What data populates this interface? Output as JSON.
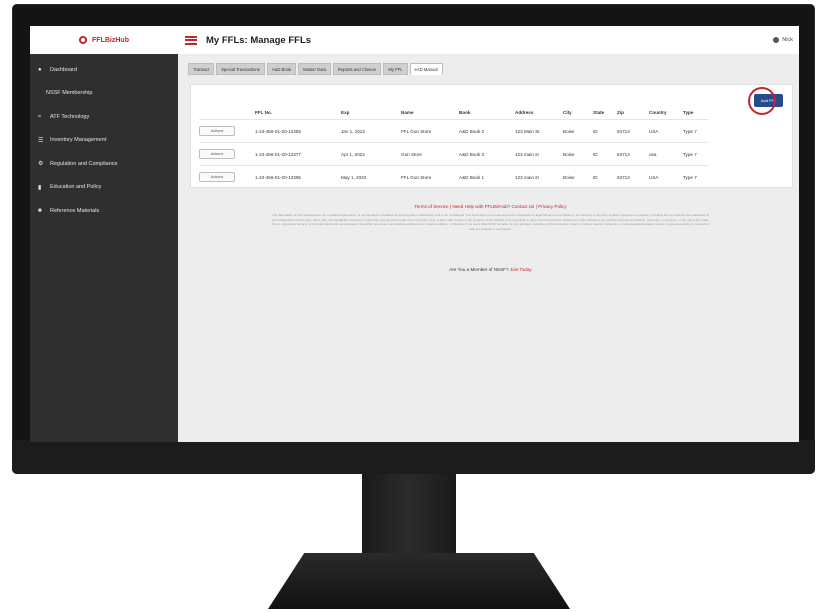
{
  "brand": {
    "name": "FFLBizHub",
    "color": "#c0262d"
  },
  "header": {
    "title": "My FFLs: Manage FFLs",
    "user_name": "Nick",
    "menu_icon": "hamburger-icon",
    "user_icon": "user-icon"
  },
  "sidebar": {
    "items": [
      {
        "label": "Dashboard",
        "icon": "home-icon"
      },
      {
        "label": "NSSF Membership",
        "icon": ""
      },
      {
        "label": "ATF Technology",
        "icon": "chart-icon"
      },
      {
        "label": "Inventory Management",
        "icon": "list-icon"
      },
      {
        "label": "Regulation and Compliance",
        "icon": "gear-icon"
      },
      {
        "label": "Education and Policy",
        "icon": "book-icon"
      },
      {
        "label": "Reference Materials",
        "icon": "document-icon"
      }
    ]
  },
  "tabs": [
    "Transact",
    "Special Transactions",
    "A&D Book",
    "Master Data",
    "Reports and Closure",
    "My FFL",
    "eAD Manual"
  ],
  "active_tab": "eAD Manual",
  "panel": {
    "add_button": "Add FFL",
    "columns": [
      "FFL No.",
      "Exp",
      "Name",
      "Book",
      "Address",
      "City",
      "State",
      "Zip",
      "Country",
      "Type"
    ],
    "action_label": "Actions",
    "rows": [
      [
        "1-23-456-01-20-12355",
        "Jan 1, 2022",
        "FFL Gun Store",
        "A&D Book 2",
        "123 Main St",
        "Boise",
        "ID",
        "83713",
        "USA",
        "Type 7"
      ],
      [
        "1-23-456-01-20-12377",
        "Apr 1, 2022",
        "Gun Store",
        "A&D Book 3",
        "123 main st",
        "Boise",
        "ID",
        "83713",
        "usa",
        "Type 7"
      ],
      [
        "1-23-456-01-20-12395",
        "May 1, 2022",
        "FFL Gun Store",
        "A&D Book 1",
        "123 main st",
        "Boise",
        "ID",
        "83713",
        "USA",
        "Type 7"
      ]
    ]
  },
  "footer": {
    "links": [
      "Terms of Service",
      "Need Help with FFLBizHub? Contact Us",
      "Privacy Policy"
    ],
    "disclaimer": "The information on this website does not constitute legal advice, is not intended to establish an attorney-client relationship, and is not confidential. The information is not intended to be a substitute for legal advice from an attorney. No warranty of any kind, implied, expressed or statutory, including but not limited to the warranties of non-infringement of third party rights, title, merchantability, fitness for a particular purpose and freedom from computer virus, is given with respect to the contents of this website or its hyperlinks to other internet resources. Reference in this website to any specific commercial products, processes, or services, or the use of any trade, firm or corporation name is for the information and convenience of the public, and does not constitute endorsement, recommendation, or favoring. In no event shall NSSF be liable for any damages, including, without limitation, direct or indirect, special, incidental, or consequential damages, losses or expenses arising in connection with this website or use thereof.",
    "member_prompt": "Are You a Member of NSSF?",
    "join_label": "Join Today"
  },
  "colors": {
    "accent": "#c0262d",
    "sidebar": "#2f2f2f",
    "button": "#274a8a",
    "background": "#ededed"
  }
}
